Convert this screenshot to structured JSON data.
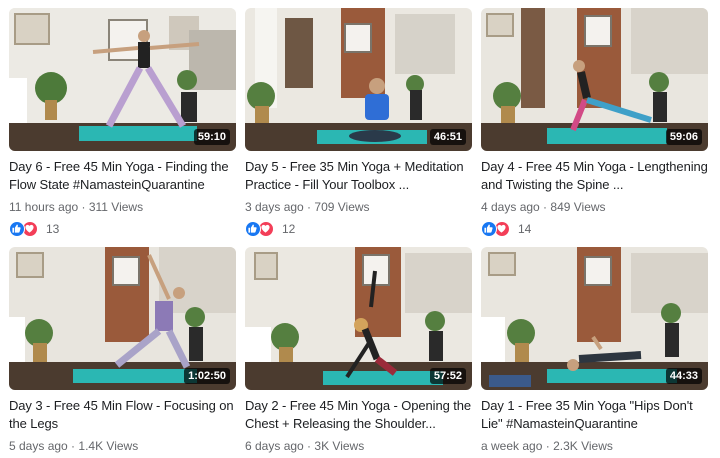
{
  "videos": [
    {
      "title": "Day 6 - Free 45 Min Yoga - Finding the Flow State #NamasteinQuarantine",
      "duration": "59:10",
      "age": "11 hours ago",
      "views": "311 Views",
      "reaction_count": "13",
      "reaction_icons": [
        "like-icon",
        "love-icon"
      ]
    },
    {
      "title": "Day 5 - Free 35 Min Yoga + Meditation Practice - Fill Your Toolbox ...",
      "duration": "46:51",
      "age": "3 days ago",
      "views": "709 Views",
      "reaction_count": "12",
      "reaction_icons": [
        "like-icon",
        "love-icon"
      ]
    },
    {
      "title": "Day 4 - Free 45 Min Yoga - Lengthening and Twisting the Spine ...",
      "duration": "59:06",
      "age": "4 days ago",
      "views": "849 Views",
      "reaction_count": "14",
      "reaction_icons": [
        "like-icon",
        "love-icon"
      ]
    },
    {
      "title": "Day 3 - Free 45 Min Flow - Focusing on the Legs",
      "duration": "1:02:50",
      "age": "5 days ago",
      "views": "1.4K Views"
    },
    {
      "title": "Day 2 - Free 45 Min Yoga - Opening the Chest + Releasing the Shoulder...",
      "duration": "57:52",
      "age": "6 days ago",
      "views": "3K Views"
    },
    {
      "title": "Day 1 - Free 35 Min Yoga \"Hips Don't Lie\" #NamasteinQuarantine",
      "duration": "44:33",
      "age": "a week ago",
      "views": "2.3K Views"
    }
  ],
  "meta_separator": " · ",
  "colors": {
    "like": "#1877f2",
    "love": "#f33e58",
    "mat": "#2bb7b3",
    "floor": "#4a3a2e",
    "wall": "#e9e6df"
  }
}
